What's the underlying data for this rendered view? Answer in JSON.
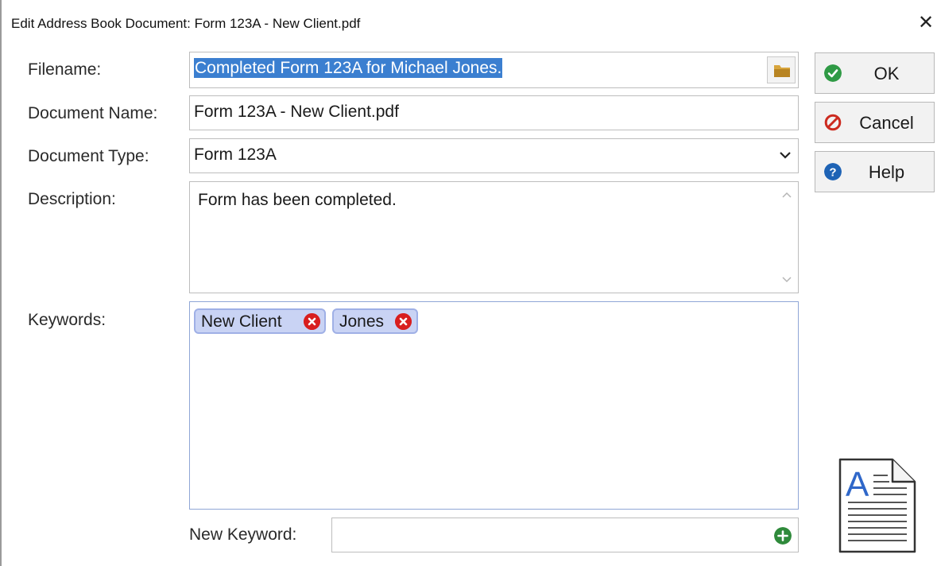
{
  "window": {
    "title": "Edit Address Book Document: Form 123A - New Client.pdf",
    "close_glyph": "✕"
  },
  "form": {
    "filename_label": "Filename:",
    "filename_value": "Completed Form 123A for Michael Jones.",
    "document_name_label": "Document Name:",
    "document_name_value": "Form 123A - New Client.pdf",
    "document_type_label": "Document Type:",
    "document_type_value": "Form 123A",
    "description_label": "Description:",
    "description_value": "Form has been completed.",
    "keywords_label": "Keywords:",
    "keywords": [
      "New Client",
      "Jones"
    ],
    "new_keyword_label": "New Keyword:",
    "new_keyword_value": ""
  },
  "buttons": {
    "ok": "OK",
    "cancel": "Cancel",
    "help": "Help"
  },
  "icons": {
    "browse": "folder-icon",
    "dropdown": "chevron-down-icon",
    "remove_keyword": "close-circle-icon",
    "add_keyword": "plus-circle-icon",
    "ok": "checkmark-circle-icon",
    "cancel": "no-entry-icon",
    "help": "question-circle-icon",
    "document": "document-text-icon"
  },
  "colors": {
    "selection": "#3b7fd0",
    "tag_bg": "#c9d3f4",
    "tag_border": "#9fb0e6",
    "remove_red": "#d81e1e",
    "ok_green": "#2f9a45",
    "cancel_red": "#cc2a1f",
    "help_blue": "#1e63b5",
    "add_green": "#2f8a3b",
    "folder_yellow": "#d8a53c"
  }
}
